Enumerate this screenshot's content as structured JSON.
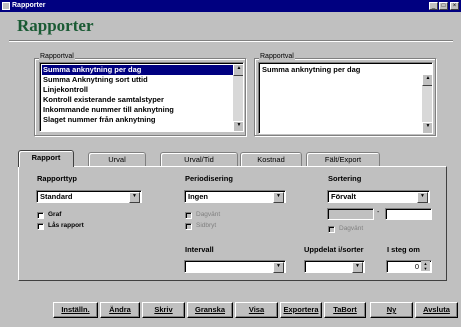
{
  "window": {
    "title": "Rapporter"
  },
  "heading": "Rapporter",
  "left_list": {
    "label": "Rapportval",
    "items": [
      "Summa anknytning per dag",
      "Summa Anknytning sort uttid",
      "Linjekontroll",
      "Kontroll existerande samtalstyper",
      "Inkommande nummer till anknytning",
      "Slaget nummer från anknytning"
    ],
    "selected_index": 0
  },
  "right_panel": {
    "label": "Rapportval",
    "value": "Summa anknytning per dag"
  },
  "tabs": [
    "Rapport",
    "Urval",
    "Urval/Tid",
    "Kostnad",
    "Fält/Export"
  ],
  "active_tab": "Rapport",
  "form": {
    "rapporttyp": {
      "label": "Rapporttyp",
      "value": "Standard"
    },
    "periodisering": {
      "label": "Periodisering",
      "value": "Ingen"
    },
    "sortering": {
      "label": "Sortering",
      "value": "Förvalt"
    },
    "graf_label": "Graf",
    "las_rapport_label": "Lås rapport",
    "dagvant_label": "Dagvänt",
    "sidbryt_label": "Sidbryt",
    "range_separator": "-",
    "dagvant2_label": "Dagvänt",
    "intervall_label": "Intervall",
    "uppdelat_label": "Uppdelat i/sorter",
    "i_steg_om_label": "I steg om",
    "i_steg_om_value": "0"
  },
  "buttons": [
    "Inställn.",
    "Ändra",
    "Skriv",
    "Granska",
    "Visa",
    "Exportera",
    "TaBort",
    "Ny",
    "Avsluta"
  ],
  "colors": {
    "title_bar": "#000080",
    "heading": "#1a5a34",
    "selection": "#000080",
    "face": "#c0c0c0"
  }
}
